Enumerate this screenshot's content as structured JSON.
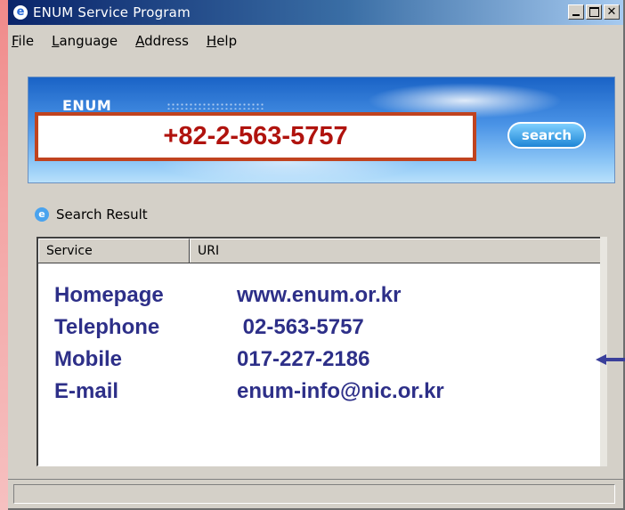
{
  "window": {
    "title": "ENUM Service Program",
    "app_icon_glyph": "e",
    "close_glyph": "✕"
  },
  "menu": {
    "items": [
      {
        "prefix": "",
        "underline": "F",
        "rest": "ile"
      },
      {
        "prefix": "",
        "underline": "L",
        "rest": "anguage"
      },
      {
        "prefix": "",
        "underline": "A",
        "rest": "ddress"
      },
      {
        "prefix": "",
        "underline": "H",
        "rest": "elp"
      }
    ]
  },
  "banner": {
    "logo_text": "ENUM",
    "phone_value": "+82-2-563-5757",
    "search_label": "search"
  },
  "results": {
    "section_label": "Search Result",
    "section_icon_glyph": "e",
    "columns": [
      "Service",
      "URI"
    ],
    "rows": [
      {
        "service": "Homepage",
        "uri": "www.enum.or.kr"
      },
      {
        "service": "Telephone",
        "uri": " 02-563-5757"
      },
      {
        "service": "Mobile",
        "uri": "017-227-2186"
      },
      {
        "service": "E-mail",
        "uri": "enum-info@nic.or.kr"
      }
    ]
  },
  "colors": {
    "accent_red": "#c0431f",
    "phone_text": "#b0130e",
    "result_text": "#2d2f88",
    "arrow": "#3a3f9a"
  }
}
